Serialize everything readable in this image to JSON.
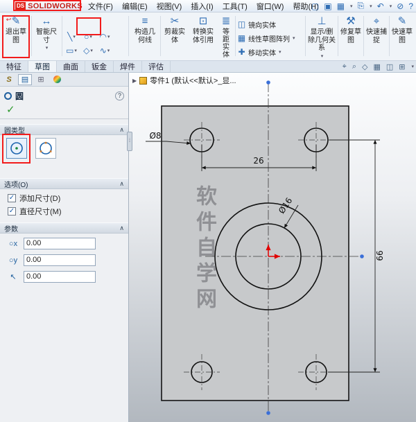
{
  "window": {
    "logo": {
      "ds": "DS",
      "brand": "SOLIDWORKS"
    },
    "menus": [
      "文件(F)",
      "编辑(E)",
      "视图(V)",
      "插入(I)",
      "工具(T)",
      "窗口(W)",
      "帮助(H)"
    ],
    "command_tabs": [
      "特征",
      "草图",
      "曲面",
      "钣金",
      "焊件",
      "评估"
    ],
    "active_tab": "草图"
  },
  "ribbon": {
    "exit_sketch": "退出草图",
    "smart_dimension": "智能尺寸",
    "construction": "构造几何线",
    "trim": "剪裁实体",
    "convert": "转换实体引用",
    "offset": "等距实体",
    "mirror": "镜向实体",
    "linear_pattern": "线性草图阵列",
    "move": "移动实体",
    "relations": "显示/删除几何关系",
    "repair": "修复草图",
    "quick_snaps": "快速捕捉",
    "rapid_sketch": "快速草图"
  },
  "panel": {
    "title": "圆",
    "circle_type_header": "圆类型",
    "options_header": "选项(O)",
    "options": [
      {
        "label": "添加尺寸(D)",
        "check": "✓"
      },
      {
        "label": "直径尺寸(M)",
        "check": "✓"
      }
    ],
    "parameters_header": "参数",
    "parameters": [
      {
        "value": "0.00"
      },
      {
        "value": "0.00"
      },
      {
        "value": "0.00"
      }
    ]
  },
  "canvas": {
    "breadcrumb": "零件1 (默认<<默认>_显...",
    "watermark": "软件自学网",
    "dims": {
      "hole_diameter": "Ø8",
      "hole_spacing": "26",
      "bore_diameter": "Ø16",
      "height": "66"
    }
  },
  "colors": {
    "brand_red": "#e2231a",
    "highlight_red": "#f21b1b",
    "origin_red": "#e00000",
    "endpoint_blue": "#3a6fd8"
  },
  "icons": {
    "dropdown": "▾",
    "collapse": "∧",
    "flyout": "▶",
    "help": "?",
    "confirm": "✓",
    "exit_sketch": "✎",
    "exit_arrow": "↩",
    "smart_dimension": "↔",
    "line": "╲",
    "circle": "○",
    "arc": "◠",
    "rectangle": "▭",
    "polygon": "◇",
    "spline": "∿",
    "fillet": "◟",
    "ellipse": "⊙",
    "text": "A",
    "construction": "≡",
    "trim": "✂",
    "convert": "⊡",
    "offset": "≣",
    "mirror": "◫",
    "pattern": "▦",
    "move": "✚",
    "relations": "⊥",
    "repair": "⚒",
    "snaps": "⌖",
    "rapid": "✎",
    "param_x": "○x",
    "param_y": "○y",
    "param_r": "↖",
    "quick": [
      "▢",
      "▣",
      "▦",
      "⎘",
      "↶",
      "⊘",
      "?"
    ],
    "tabstrip": [
      "S",
      "▤",
      "⊞"
    ],
    "headsup": [
      "⌖",
      "⌕",
      "◇",
      "▦",
      "◫",
      "⊞"
    ]
  }
}
